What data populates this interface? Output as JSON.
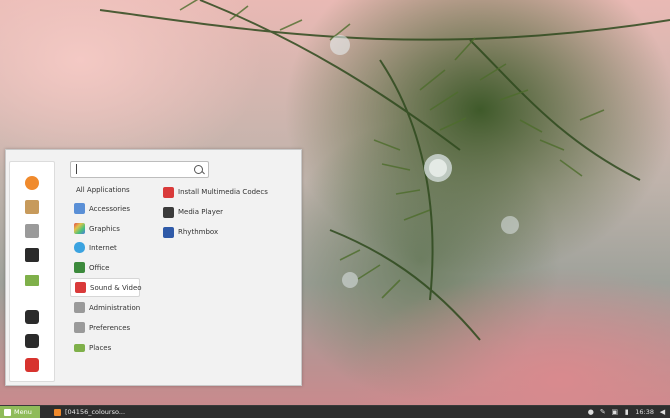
{
  "colors": {
    "panel_bg": "#f2f2f2",
    "accent_green": "#8fbb5a",
    "taskbar_bg": "#2e2e2e"
  },
  "search": {
    "value": "",
    "placeholder": ""
  },
  "favorites": [
    {
      "name": "firefox-icon",
      "color": "#f08a2c"
    },
    {
      "name": "software-manager-icon",
      "color": "#c79a5b"
    },
    {
      "name": "settings-icon",
      "color": "#8a8a8a"
    },
    {
      "name": "terminal-icon",
      "color": "#2b2b2b"
    },
    {
      "name": "folder-icon",
      "color": "#7fb04a"
    },
    {
      "name": "lock-icon",
      "color": "#2b2b2b"
    },
    {
      "name": "logout-icon",
      "color": "#2b2b2b"
    },
    {
      "name": "power-icon",
      "color": "#d7332e"
    }
  ],
  "categories": [
    {
      "label": "All Applications",
      "icon": "",
      "color": ""
    },
    {
      "label": "Accessories",
      "icon": "accessories-icon",
      "color": "#5a8fd6"
    },
    {
      "label": "Graphics",
      "icon": "graphics-icon",
      "color": "#b04fc9"
    },
    {
      "label": "Internet",
      "icon": "internet-icon",
      "color": "#3ba3e0"
    },
    {
      "label": "Office",
      "icon": "office-icon",
      "color": "#3c8a3c"
    },
    {
      "label": "Sound & Video",
      "icon": "sound-video-icon",
      "color": "#d93a3a"
    },
    {
      "label": "Administration",
      "icon": "administration-icon",
      "color": "#8a8a8a"
    },
    {
      "label": "Preferences",
      "icon": "preferences-icon",
      "color": "#8a8a8a"
    },
    {
      "label": "Places",
      "icon": "places-folder-icon",
      "color": "#7fb04a"
    }
  ],
  "apps": [
    {
      "label": "Install Multimedia Codecs",
      "icon": "codecs-icon",
      "color": "#d93a3a"
    },
    {
      "label": "Media Player",
      "icon": "media-player-icon",
      "color": "#3b3b3b"
    },
    {
      "label": "Rhythmbox",
      "icon": "rhythmbox-icon",
      "color": "#2f5aa8"
    }
  ],
  "taskbar": {
    "menu_label": "Menu",
    "task_label": "[04156_colourso...",
    "clock": "16:38"
  }
}
